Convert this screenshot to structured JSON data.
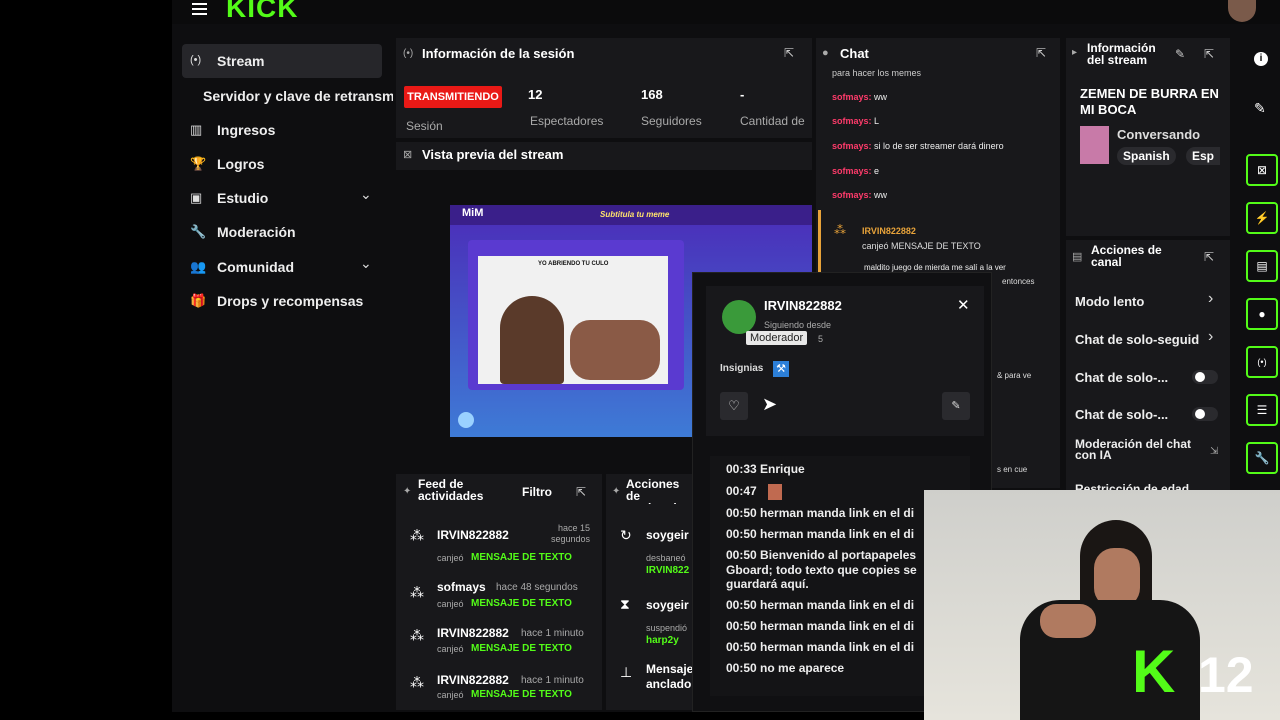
{
  "header": {
    "logo": "KICK"
  },
  "sidebar": {
    "items": [
      {
        "label": "Stream",
        "icon": "broadcast-icon"
      },
      {
        "label": "Servidor y clave de retransm"
      },
      {
        "label": "Ingresos",
        "icon": "chart-icon"
      },
      {
        "label": "Logros",
        "icon": "trophy-icon"
      },
      {
        "label": "Estudio",
        "icon": "studio-icon"
      },
      {
        "label": "Moderación",
        "icon": "wrench-icon"
      },
      {
        "label": "Comunidad",
        "icon": "community-icon"
      },
      {
        "label": "Drops y recompensas",
        "icon": "drops-icon"
      }
    ]
  },
  "session": {
    "title": "Información de la sesión",
    "status": "TRANSMITIENDO",
    "status_label": "Sesión",
    "stats": [
      {
        "value": "12",
        "label": "Espectadores"
      },
      {
        "value": "168",
        "label": "Seguidores"
      },
      {
        "value": "-",
        "label": "Cantidad de"
      }
    ]
  },
  "preview": {
    "title": "Vista previa del stream",
    "site_title": "Subtitula tu meme",
    "meme_text": "YO ABRIENDO TU CULO"
  },
  "chat": {
    "title": "Chat",
    "lines": [
      {
        "user": "",
        "text": "para hacer los memes"
      },
      {
        "user": "sofmays:",
        "text": "ww"
      },
      {
        "user": "sofmays:",
        "text": "L"
      },
      {
        "user": "sofmays:",
        "text": "si lo de ser streamer dará dinero"
      },
      {
        "user": "sofmays:",
        "text": "e"
      },
      {
        "user": "sofmays:",
        "text": "ww"
      }
    ],
    "redeem_user": "IRVIN822882",
    "redeem_text": "canjeó MENSAJE DE TEXTO",
    "redeem_msg": "maldito juego de mierda me salí a la ver",
    "redeem_msg2": "entonces",
    "frag1": "& para ve",
    "frag2": "s en cue"
  },
  "stream_info": {
    "title": "Información del stream",
    "stream_title": "ZEMEN DE BURRA EN MI BOCA",
    "category": "Conversando",
    "tags": [
      "Spanish",
      "Esp"
    ]
  },
  "channel_actions": {
    "title": "Acciones de canal",
    "items": [
      "Modo lento",
      "Chat de solo-seguid",
      "Chat de solo-...",
      "Chat de solo-...",
      "Moderación del chat con IA",
      "Restricción de edad"
    ]
  },
  "user_card": {
    "username": "IRVIN822882",
    "following": "Siguiendo desde",
    "following_value": "5",
    "tooltip": "Moderador",
    "badges_label": "Insignias"
  },
  "messages": [
    {
      "time": "00:33",
      "text": "Enrique"
    },
    {
      "time": "00:47",
      "text": ""
    },
    {
      "time": "00:50",
      "text": "herman manda link en el di"
    },
    {
      "time": "00:50",
      "text": "herman manda link en el di"
    },
    {
      "time": "00:50",
      "text": "Bienvenido al portapapeles"
    },
    {
      "time": "",
      "text": "Gboard; todo texto que copies se"
    },
    {
      "time": "",
      "text": "guardará aquí."
    },
    {
      "time": "00:50",
      "text": "herman manda link en el di"
    },
    {
      "time": "00:50",
      "text": "herman manda link en el di"
    },
    {
      "time": "00:50",
      "text": "herman manda link en el di"
    },
    {
      "time": "00:50",
      "text": "no me aparece"
    }
  ],
  "feed": {
    "title": "Feed de actividades",
    "filter": "Filtro",
    "items": [
      {
        "user": "IRVIN822882",
        "time": "hace 15 segundos",
        "action": "canjeó",
        "reward": "MENSAJE DE TEXTO"
      },
      {
        "user": "sofmays",
        "time": "hace 48 segundos",
        "action": "canjeó",
        "reward": "MENSAJE DE TEXTO"
      },
      {
        "user": "IRVIN822882",
        "time": "hace 1 minuto",
        "action": "canjeó",
        "reward": "MENSAJE DE TEXTO"
      },
      {
        "user": "IRVIN822882",
        "time": "hace 1 minuto",
        "action": "canjeó",
        "reward": "MENSAJE DE TEXTO"
      }
    ]
  },
  "mod_actions": {
    "title": "Acciones de moderador",
    "items": [
      {
        "user": "soygeir",
        "action": "desbaneó",
        "target": "IRVIN822"
      },
      {
        "user": "soygeir",
        "action": "suspendió",
        "target": "harp2y"
      },
      {
        "user": "Mensaje",
        "action": "anclado"
      }
    ]
  },
  "webcam": {
    "viewers": "12"
  },
  "colors": {
    "accent": "#53fc18",
    "live": "#e91916",
    "bg": "#0e0e10",
    "panel": "#18181b"
  }
}
